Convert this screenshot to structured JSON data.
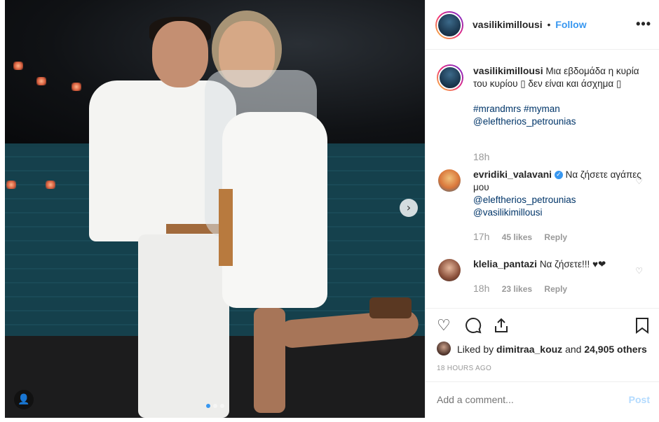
{
  "post": {
    "username": "vasilikimillousi",
    "separator": "•",
    "follow_label": "Follow",
    "more_icon": "more-horizontal-icon"
  },
  "photo": {
    "next_icon": "chevron-right-icon",
    "user_tag_icon": "user-tag-icon",
    "carousel": {
      "total": 3,
      "active": 1
    }
  },
  "caption": {
    "username": "vasilikimillousi",
    "text": "Μια εβδομάδα η κυρία του κυρίου ▯ δεν είναι και άσχημα ▯",
    "hashtags": "#mrandmrs #myman",
    "mention": "@eleftherios_petrounias",
    "age": "18h"
  },
  "comments": [
    {
      "username": "evridiki_valavani",
      "verified": true,
      "text": "Να ζήσετε αγάπες μου",
      "mention1": "@eleftherios_petrounias",
      "mention2": "@vasilikimillousi",
      "age": "17h",
      "likes": "45 likes",
      "reply": "Reply"
    },
    {
      "username": "klelia_pantazi",
      "text": "Να ζήσετε!!! ♥❤",
      "age": "18h",
      "likes": "23 likes",
      "reply": "Reply"
    }
  ],
  "actions": {
    "like_icon": "heart-icon",
    "comment_icon": "comment-icon",
    "share_icon": "share-icon",
    "save_icon": "bookmark-icon",
    "liked_by_prefix": "Liked by",
    "liked_by_user": "dimitraa_kouz",
    "liked_by_and": "and",
    "liked_by_others": "24,905 others",
    "timestamp": "18 HOURS AGO"
  },
  "comment_box": {
    "placeholder": "Add a comment...",
    "post_label": "Post"
  },
  "colors": {
    "accent": "#3897f0",
    "post_disabled": "#b3dbff",
    "muted": "#999999"
  }
}
